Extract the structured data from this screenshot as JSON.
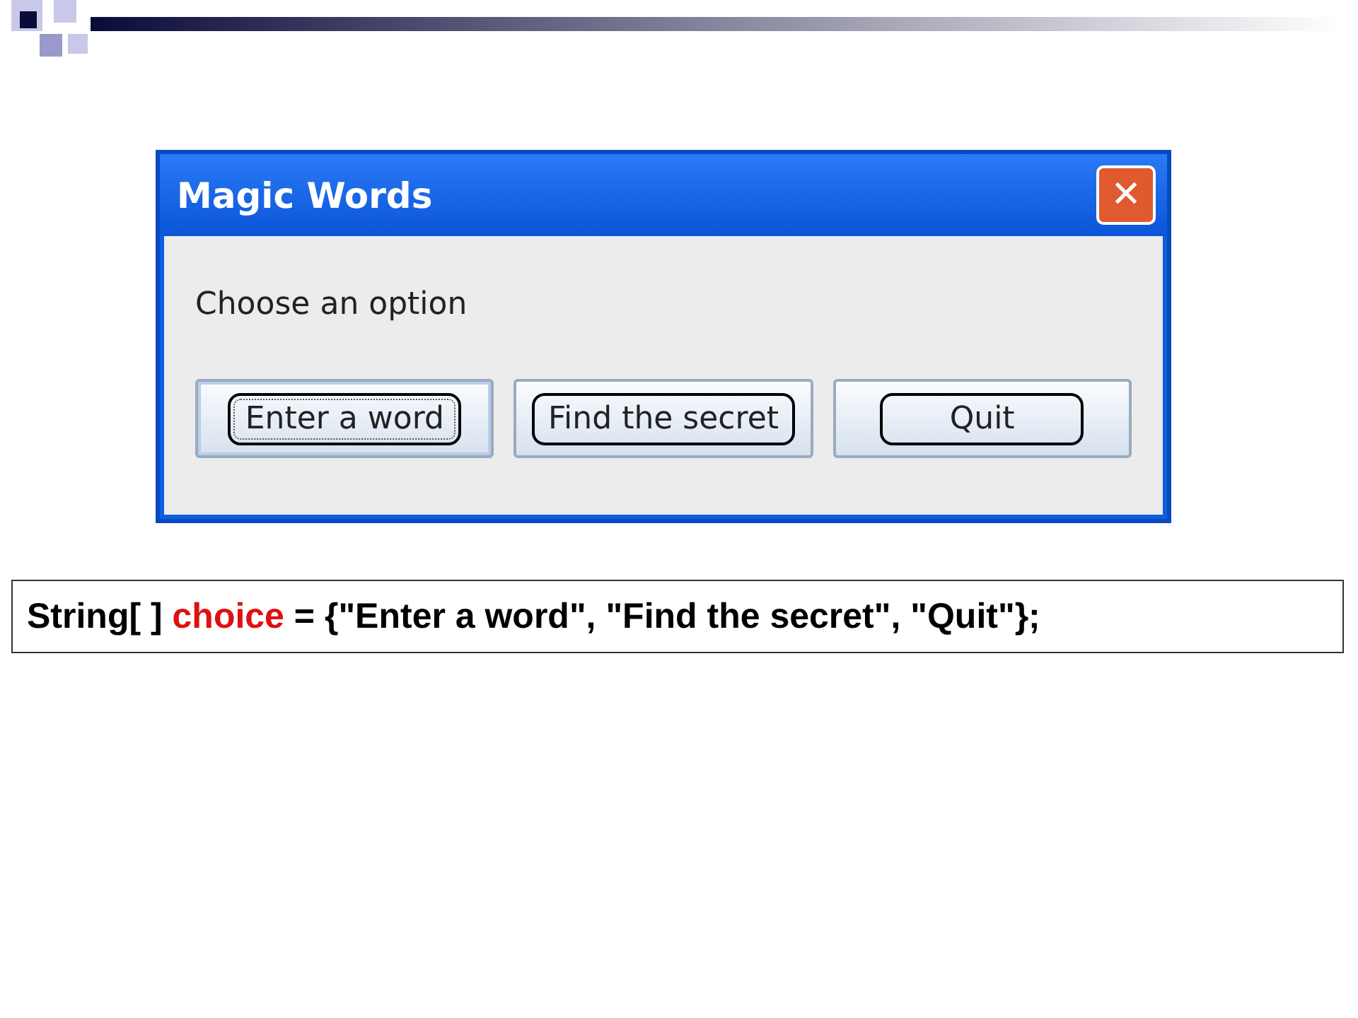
{
  "window": {
    "title": "Magic Words",
    "close_label": "✕"
  },
  "message": "Choose an option",
  "buttons": [
    {
      "label": "Enter a word",
      "focused": true
    },
    {
      "label": "Find the secret",
      "focused": false
    },
    {
      "label": "Quit",
      "focused": false
    }
  ],
  "code_line": [
    {
      "text": "String[ ] ",
      "highlight": false
    },
    {
      "text": "choice",
      "highlight": true
    },
    {
      "text": " = {\"Enter a word\", \"Find the secret\", \"Quit\"};",
      "highlight": false
    }
  ]
}
